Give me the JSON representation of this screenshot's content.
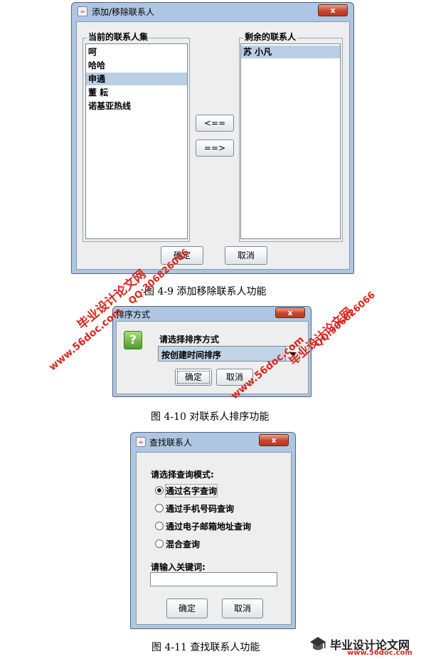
{
  "dialog1": {
    "title": "添加/移除联系人",
    "current_group_label": "当前的联系人集",
    "remaining_group_label": "剩余的联系人",
    "current_items": [
      "呵",
      "哈哈",
      "申通",
      "董 耘",
      "诺基亚热线"
    ],
    "remaining_items": [
      "苏 小凡"
    ],
    "move_left_label": "<==",
    "move_right_label": "==>",
    "ok_label": "确定",
    "cancel_label": "取消",
    "close_label": "x"
  },
  "caption1": "图 4-9 添加移除联系人功能",
  "dialog2": {
    "title": "排序方式",
    "prompt": "请选择排序方式",
    "selected_option": "按创建时间排序",
    "question_mark": "?",
    "ok_label": "确定",
    "cancel_label": "取消",
    "close_label": "x"
  },
  "caption2": "图 4-10 对联系人排序功能",
  "dialog3": {
    "title": "查找联系人",
    "mode_prompt": "请选择查询模式:",
    "options": [
      "通过名字查询",
      "通过手机号码查询",
      "通过电子邮箱地址查询",
      "混合查询"
    ],
    "selected_index": 0,
    "keyword_label": "请输入关键词:",
    "keyword_value": "",
    "ok_label": "确定",
    "cancel_label": "取消",
    "close_label": "x"
  },
  "caption3": "图 4-11 查找联系人功能",
  "watermarks": {
    "site": "www.56doc.com",
    "brand": "毕业设计论文网",
    "qq": "QQ:306826066"
  },
  "colors": {
    "selection": "#b8cfe5",
    "watermark_red": "#d9261c"
  }
}
